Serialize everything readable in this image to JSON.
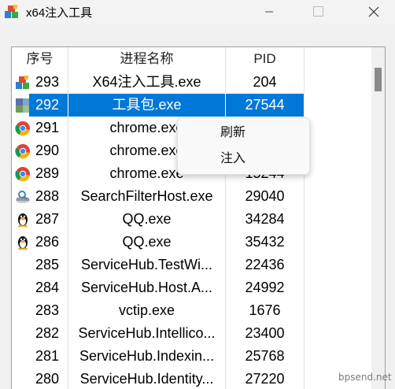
{
  "window": {
    "title": "x64注入工具"
  },
  "columns": {
    "seq": "序号",
    "name": "进程名称",
    "pid": "PID"
  },
  "rows": [
    {
      "seq": "293",
      "name": "X64注入工具.exe",
      "pid": "204",
      "icon": "injector-app-icon"
    },
    {
      "seq": "292",
      "name": "工具包.exe",
      "pid": "27544",
      "icon": "toolkit-app-icon"
    },
    {
      "seq": "291",
      "name": "chrome.exe",
      "pid": "",
      "icon": "chrome-icon"
    },
    {
      "seq": "290",
      "name": "chrome.exe",
      "pid": "",
      "icon": "chrome-icon"
    },
    {
      "seq": "289",
      "name": "chrome.exe",
      "pid": "15244",
      "icon": "chrome-icon"
    },
    {
      "seq": "288",
      "name": "SearchFilterHost.exe",
      "pid": "29040",
      "icon": "search-filter-icon"
    },
    {
      "seq": "287",
      "name": "QQ.exe",
      "pid": "34284",
      "icon": "qq-penguin-icon"
    },
    {
      "seq": "286",
      "name": "QQ.exe",
      "pid": "35432",
      "icon": "qq-penguin-icon"
    },
    {
      "seq": "285",
      "name": "ServiceHub.TestWi...",
      "pid": "22436",
      "icon": ""
    },
    {
      "seq": "284",
      "name": "ServiceHub.Host.A...",
      "pid": "24992",
      "icon": ""
    },
    {
      "seq": "283",
      "name": "vctip.exe",
      "pid": "1676",
      "icon": ""
    },
    {
      "seq": "282",
      "name": "ServiceHub.Intellico...",
      "pid": "23400",
      "icon": ""
    },
    {
      "seq": "281",
      "name": "ServiceHub.Indexin...",
      "pid": "25768",
      "icon": ""
    },
    {
      "seq": "280",
      "name": "ServiceHub.Identity...",
      "pid": "27220",
      "icon": ""
    }
  ],
  "context_menu": {
    "refresh": "刷新",
    "inject": "注入"
  },
  "watermark": "bpsend.net",
  "colors": {
    "selection": "#0078d7"
  }
}
